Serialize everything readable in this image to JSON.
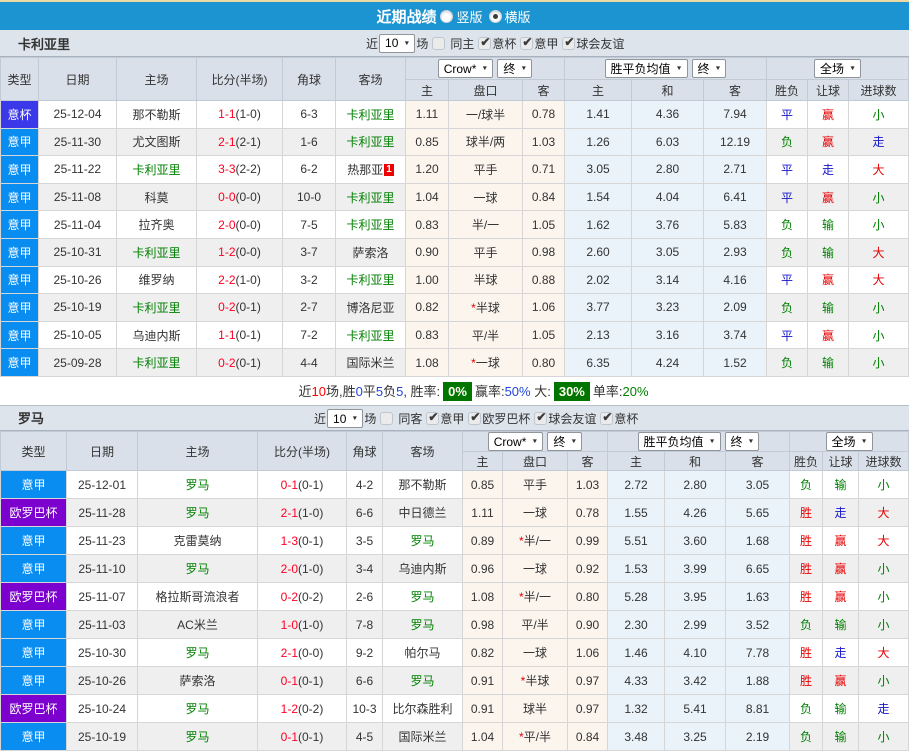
{
  "title_bar": {
    "title": "近期战绩",
    "radios": [
      {
        "label": "竖版",
        "selected": false
      },
      {
        "label": "横版",
        "selected": true
      }
    ]
  },
  "league_colors": {
    "意杯": "#3B38E9",
    "意甲": "#0A8DF0",
    "欧罗巴杯": "#7C00CE"
  },
  "header": {
    "left_cols": [
      "类型",
      "日期",
      "主场",
      "比分(半场)",
      "角球",
      "客场"
    ],
    "sub_cols": [
      "主",
      "盘口",
      "客",
      "主",
      "和",
      "客",
      "胜负",
      "让球",
      "进球数"
    ],
    "group_selects": {
      "odds_company": "Crow*",
      "odds_time": "终",
      "avg": "胜平负均值",
      "avg_time": "终",
      "scope": "全场"
    }
  },
  "sections": [
    {
      "team": "卡利亚里",
      "filter": {
        "prefix": "近",
        "count": "10",
        "suffix": "场",
        "checkboxes": [
          {
            "label": "同主",
            "checked": false
          },
          {
            "label": "意杯",
            "checked": true
          },
          {
            "label": "意甲",
            "checked": true
          },
          {
            "label": "球会友谊",
            "checked": true
          }
        ]
      },
      "rows": [
        {
          "league": "意杯",
          "date": "25-12-04",
          "home": "那不勒斯",
          "home_green": false,
          "score": "1-1",
          "half": "(1-0)",
          "corner": "6-3",
          "away": "卡利亚里",
          "away_green": true,
          "red_card": "",
          "odds": [
            "1.11",
            "一/球半",
            "0.78"
          ],
          "star": false,
          "avg": [
            "1.41",
            "4.36",
            "7.94"
          ],
          "result": "平",
          "result_c": "blue",
          "handicap": "赢",
          "handicap_c": "red",
          "goals": "小",
          "goals_c": "green"
        },
        {
          "league": "意甲",
          "date": "25-11-30",
          "home": "尤文图斯",
          "home_green": false,
          "score": "2-1",
          "half": "(2-1)",
          "corner": "1-6",
          "away": "卡利亚里",
          "away_green": true,
          "red_card": "",
          "odds": [
            "0.85",
            "球半/两",
            "1.03"
          ],
          "star": false,
          "avg": [
            "1.26",
            "6.03",
            "12.19"
          ],
          "result": "负",
          "result_c": "green",
          "handicap": "赢",
          "handicap_c": "red",
          "goals": "走",
          "goals_c": "blue"
        },
        {
          "league": "意甲",
          "date": "25-11-22",
          "home": "卡利亚里",
          "home_green": true,
          "score": "3-3",
          "half": "(2-2)",
          "corner": "6-2",
          "away": "热那亚",
          "away_green": false,
          "red_card": "1",
          "odds": [
            "1.20",
            "平手",
            "0.71"
          ],
          "star": false,
          "avg": [
            "3.05",
            "2.80",
            "2.71"
          ],
          "result": "平",
          "result_c": "blue",
          "handicap": "走",
          "handicap_c": "blue",
          "goals": "大",
          "goals_c": "red"
        },
        {
          "league": "意甲",
          "date": "25-11-08",
          "home": "科莫",
          "home_green": false,
          "score": "0-0",
          "half": "(0-0)",
          "corner": "10-0",
          "away": "卡利亚里",
          "away_green": true,
          "red_card": "",
          "odds": [
            "1.04",
            "一球",
            "0.84"
          ],
          "star": false,
          "avg": [
            "1.54",
            "4.04",
            "6.41"
          ],
          "result": "平",
          "result_c": "blue",
          "handicap": "赢",
          "handicap_c": "red",
          "goals": "小",
          "goals_c": "green"
        },
        {
          "league": "意甲",
          "date": "25-11-04",
          "home": "拉齐奥",
          "home_green": false,
          "score": "2-0",
          "half": "(0-0)",
          "corner": "7-5",
          "away": "卡利亚里",
          "away_green": true,
          "red_card": "",
          "odds": [
            "0.83",
            "半/一",
            "1.05"
          ],
          "star": false,
          "avg": [
            "1.62",
            "3.76",
            "5.83"
          ],
          "result": "负",
          "result_c": "green",
          "handicap": "输",
          "handicap_c": "green",
          "goals": "小",
          "goals_c": "green"
        },
        {
          "league": "意甲",
          "date": "25-10-31",
          "home": "卡利亚里",
          "home_green": true,
          "score": "1-2",
          "half": "(0-0)",
          "corner": "3-7",
          "away": "萨索洛",
          "away_green": false,
          "red_card": "",
          "odds": [
            "0.90",
            "平手",
            "0.98"
          ],
          "star": false,
          "avg": [
            "2.60",
            "3.05",
            "2.93"
          ],
          "result": "负",
          "result_c": "green",
          "handicap": "输",
          "handicap_c": "green",
          "goals": "大",
          "goals_c": "red"
        },
        {
          "league": "意甲",
          "date": "25-10-26",
          "home": "维罗纳",
          "home_green": false,
          "score": "2-2",
          "half": "(1-0)",
          "corner": "3-2",
          "away": "卡利亚里",
          "away_green": true,
          "red_card": "",
          "odds": [
            "1.00",
            "半球",
            "0.88"
          ],
          "star": false,
          "avg": [
            "2.02",
            "3.14",
            "4.16"
          ],
          "result": "平",
          "result_c": "blue",
          "handicap": "赢",
          "handicap_c": "red",
          "goals": "大",
          "goals_c": "red"
        },
        {
          "league": "意甲",
          "date": "25-10-19",
          "home": "卡利亚里",
          "home_green": true,
          "score": "0-2",
          "half": "(0-1)",
          "corner": "2-7",
          "away": "博洛尼亚",
          "away_green": false,
          "red_card": "",
          "odds": [
            "0.82",
            "半球",
            "1.06"
          ],
          "star": true,
          "avg": [
            "3.77",
            "3.23",
            "2.09"
          ],
          "result": "负",
          "result_c": "green",
          "handicap": "输",
          "handicap_c": "green",
          "goals": "小",
          "goals_c": "green"
        },
        {
          "league": "意甲",
          "date": "25-10-05",
          "home": "乌迪内斯",
          "home_green": false,
          "score": "1-1",
          "half": "(0-1)",
          "corner": "7-2",
          "away": "卡利亚里",
          "away_green": true,
          "red_card": "",
          "odds": [
            "0.83",
            "平/半",
            "1.05"
          ],
          "star": false,
          "avg": [
            "2.13",
            "3.16",
            "3.74"
          ],
          "result": "平",
          "result_c": "blue",
          "handicap": "赢",
          "handicap_c": "red",
          "goals": "小",
          "goals_c": "green"
        },
        {
          "league": "意甲",
          "date": "25-09-28",
          "home": "卡利亚里",
          "home_green": true,
          "score": "0-2",
          "half": "(0-1)",
          "corner": "4-4",
          "away": "国际米兰",
          "away_green": false,
          "red_card": "",
          "odds": [
            "1.08",
            "一球",
            "0.80"
          ],
          "star": true,
          "avg": [
            "6.35",
            "4.24",
            "1.52"
          ],
          "result": "负",
          "result_c": "green",
          "handicap": "输",
          "handicap_c": "green",
          "goals": "小",
          "goals_c": "green"
        }
      ],
      "summary": [
        {
          "t": "近",
          "c": "k"
        },
        {
          "t": "10",
          "c": "r"
        },
        {
          "t": "场,胜",
          "c": "k"
        },
        {
          "t": "0",
          "c": "b"
        },
        {
          "t": "平",
          "c": "k"
        },
        {
          "t": "5",
          "c": "b"
        },
        {
          "t": "负",
          "c": "k"
        },
        {
          "t": "5",
          "c": "b"
        },
        {
          "t": ", 胜率:",
          "c": "k"
        },
        {
          "t": "0%",
          "c": "badge"
        },
        {
          "t": "赢率:",
          "c": "k"
        },
        {
          "t": "50%",
          "c": "b"
        },
        {
          "t": " 大:",
          "c": "k"
        },
        {
          "t": "30%",
          "c": "badge"
        },
        {
          "t": "单率:",
          "c": "k"
        },
        {
          "t": "20%",
          "c": "g"
        }
      ]
    },
    {
      "team": "罗马",
      "filter": {
        "prefix": "近",
        "count": "10",
        "suffix": "场",
        "checkboxes": [
          {
            "label": "同客",
            "checked": false
          },
          {
            "label": "意甲",
            "checked": true
          },
          {
            "label": "欧罗巴杯",
            "checked": true
          },
          {
            "label": "球会友谊",
            "checked": true
          },
          {
            "label": "意杯",
            "checked": true
          }
        ]
      },
      "rows": [
        {
          "league": "意甲",
          "date": "25-12-01",
          "home": "罗马",
          "home_green": true,
          "score": "0-1",
          "half": "(0-1)",
          "corner": "4-2",
          "away": "那不勒斯",
          "away_green": false,
          "red_card": "",
          "odds": [
            "0.85",
            "平手",
            "1.03"
          ],
          "star": false,
          "avg": [
            "2.72",
            "2.80",
            "3.05"
          ],
          "result": "负",
          "result_c": "green",
          "handicap": "输",
          "handicap_c": "green",
          "goals": "小",
          "goals_c": "green"
        },
        {
          "league": "欧罗巴杯",
          "date": "25-11-28",
          "home": "罗马",
          "home_green": true,
          "score": "2-1",
          "half": "(1-0)",
          "corner": "6-6",
          "away": "中日德兰",
          "away_green": false,
          "red_card": "",
          "odds": [
            "1.11",
            "一球",
            "0.78"
          ],
          "star": false,
          "avg": [
            "1.55",
            "4.26",
            "5.65"
          ],
          "result": "胜",
          "result_c": "red",
          "handicap": "走",
          "handicap_c": "blue",
          "goals": "大",
          "goals_c": "red"
        },
        {
          "league": "意甲",
          "date": "25-11-23",
          "home": "克雷莫纳",
          "home_green": false,
          "score": "1-3",
          "half": "(0-1)",
          "corner": "3-5",
          "away": "罗马",
          "away_green": true,
          "red_card": "",
          "odds": [
            "0.89",
            "半/一",
            "0.99"
          ],
          "star": true,
          "avg": [
            "5.51",
            "3.60",
            "1.68"
          ],
          "result": "胜",
          "result_c": "red",
          "handicap": "赢",
          "handicap_c": "red",
          "goals": "大",
          "goals_c": "red"
        },
        {
          "league": "意甲",
          "date": "25-11-10",
          "home": "罗马",
          "home_green": true,
          "score": "2-0",
          "half": "(1-0)",
          "corner": "3-4",
          "away": "乌迪内斯",
          "away_green": false,
          "red_card": "",
          "odds": [
            "0.96",
            "一球",
            "0.92"
          ],
          "star": false,
          "avg": [
            "1.53",
            "3.99",
            "6.65"
          ],
          "result": "胜",
          "result_c": "red",
          "handicap": "赢",
          "handicap_c": "red",
          "goals": "小",
          "goals_c": "green"
        },
        {
          "league": "欧罗巴杯",
          "date": "25-11-07",
          "home": "格拉斯哥流浪者",
          "home_green": false,
          "score": "0-2",
          "half": "(0-2)",
          "corner": "2-6",
          "away": "罗马",
          "away_green": true,
          "red_card": "",
          "odds": [
            "1.08",
            "半/一",
            "0.80"
          ],
          "star": true,
          "avg": [
            "5.28",
            "3.95",
            "1.63"
          ],
          "result": "胜",
          "result_c": "red",
          "handicap": "赢",
          "handicap_c": "red",
          "goals": "小",
          "goals_c": "green"
        },
        {
          "league": "意甲",
          "date": "25-11-03",
          "home": "AC米兰",
          "home_green": false,
          "score": "1-0",
          "half": "(1-0)",
          "corner": "7-8",
          "away": "罗马",
          "away_green": true,
          "red_card": "",
          "odds": [
            "0.98",
            "平/半",
            "0.90"
          ],
          "star": false,
          "avg": [
            "2.30",
            "2.99",
            "3.52"
          ],
          "result": "负",
          "result_c": "green",
          "handicap": "输",
          "handicap_c": "green",
          "goals": "小",
          "goals_c": "green"
        },
        {
          "league": "意甲",
          "date": "25-10-30",
          "home": "罗马",
          "home_green": true,
          "score": "2-1",
          "half": "(0-0)",
          "corner": "9-2",
          "away": "帕尔马",
          "away_green": false,
          "red_card": "",
          "odds": [
            "0.82",
            "一球",
            "1.06"
          ],
          "star": false,
          "avg": [
            "1.46",
            "4.10",
            "7.78"
          ],
          "result": "胜",
          "result_c": "red",
          "handicap": "走",
          "handicap_c": "blue",
          "goals": "大",
          "goals_c": "red"
        },
        {
          "league": "意甲",
          "date": "25-10-26",
          "home": "萨索洛",
          "home_green": false,
          "score": "0-1",
          "half": "(0-1)",
          "corner": "6-6",
          "away": "罗马",
          "away_green": true,
          "red_card": "",
          "odds": [
            "0.91",
            "半球",
            "0.97"
          ],
          "star": true,
          "avg": [
            "4.33",
            "3.42",
            "1.88"
          ],
          "result": "胜",
          "result_c": "red",
          "handicap": "赢",
          "handicap_c": "red",
          "goals": "小",
          "goals_c": "green"
        },
        {
          "league": "欧罗巴杯",
          "date": "25-10-24",
          "home": "罗马",
          "home_green": true,
          "score": "1-2",
          "half": "(0-2)",
          "corner": "10-3",
          "away": "比尔森胜利",
          "away_green": false,
          "red_card": "",
          "odds": [
            "0.91",
            "球半",
            "0.97"
          ],
          "star": false,
          "avg": [
            "1.32",
            "5.41",
            "8.81"
          ],
          "result": "负",
          "result_c": "green",
          "handicap": "输",
          "handicap_c": "green",
          "goals": "走",
          "goals_c": "blue"
        },
        {
          "league": "意甲",
          "date": "25-10-19",
          "home": "罗马",
          "home_green": true,
          "score": "0-1",
          "half": "(0-1)",
          "corner": "4-5",
          "away": "国际米兰",
          "away_green": false,
          "red_card": "",
          "odds": [
            "1.04",
            "平/半",
            "0.84"
          ],
          "star": true,
          "avg": [
            "3.48",
            "3.25",
            "2.19"
          ],
          "result": "负",
          "result_c": "green",
          "handicap": "输",
          "handicap_c": "green",
          "goals": "小",
          "goals_c": "green"
        }
      ],
      "summary": []
    }
  ]
}
